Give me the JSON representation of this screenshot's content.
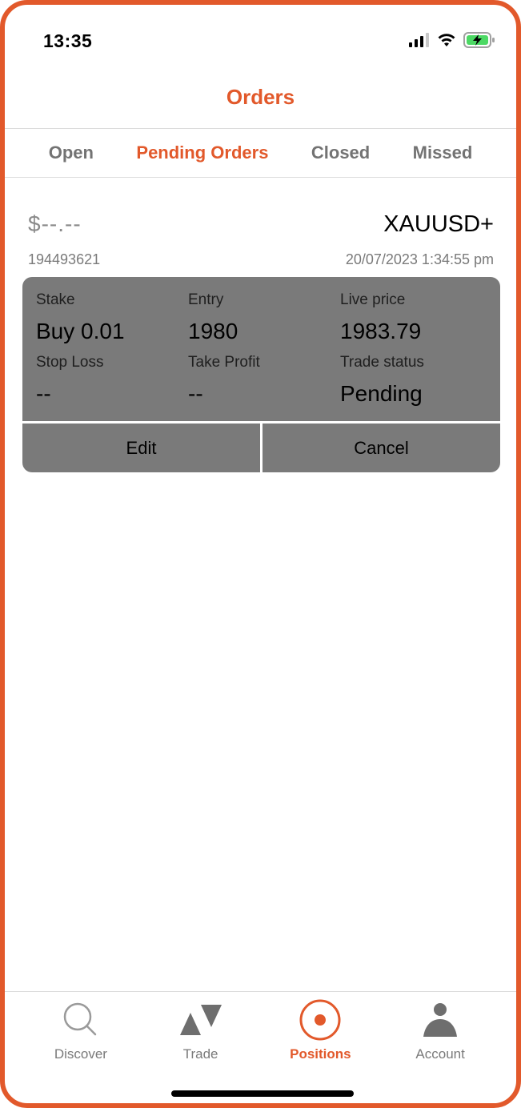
{
  "status_bar": {
    "time": "13:35",
    "icons": [
      "signal-icon",
      "wifi-icon",
      "battery-charging-icon"
    ]
  },
  "header": {
    "title": "Orders"
  },
  "tabs": [
    {
      "label": "Open",
      "active": false
    },
    {
      "label": "Pending Orders",
      "active": true
    },
    {
      "label": "Closed",
      "active": false
    },
    {
      "label": "Missed",
      "active": false
    }
  ],
  "order": {
    "amount": "$--.--",
    "symbol": "XAUUSD+",
    "id": "194493621",
    "datetime": "20/07/2023 1:34:55 pm",
    "fields": {
      "stake": {
        "label": "Stake",
        "value": "Buy 0.01"
      },
      "entry": {
        "label": "Entry",
        "value": "1980"
      },
      "live_price": {
        "label": "Live price",
        "value": "1983.79"
      },
      "stop_loss": {
        "label": "Stop Loss",
        "value": "--"
      },
      "take_profit": {
        "label": "Take Profit",
        "value": "--"
      },
      "trade_status": {
        "label": "Trade status",
        "value": "Pending"
      }
    },
    "actions": {
      "edit": "Edit",
      "cancel": "Cancel"
    }
  },
  "bottom_nav": [
    {
      "label": "Discover",
      "icon": "search-icon",
      "active": false
    },
    {
      "label": "Trade",
      "icon": "trade-arrows-icon",
      "active": false
    },
    {
      "label": "Positions",
      "icon": "positions-target-icon",
      "active": true
    },
    {
      "label": "Account",
      "icon": "person-icon",
      "active": false
    }
  ],
  "colors": {
    "accent": "#e2592b",
    "card_bg": "#7a7a7a",
    "muted_text": "#7a7a7a",
    "divider": "#dcdcdc"
  }
}
